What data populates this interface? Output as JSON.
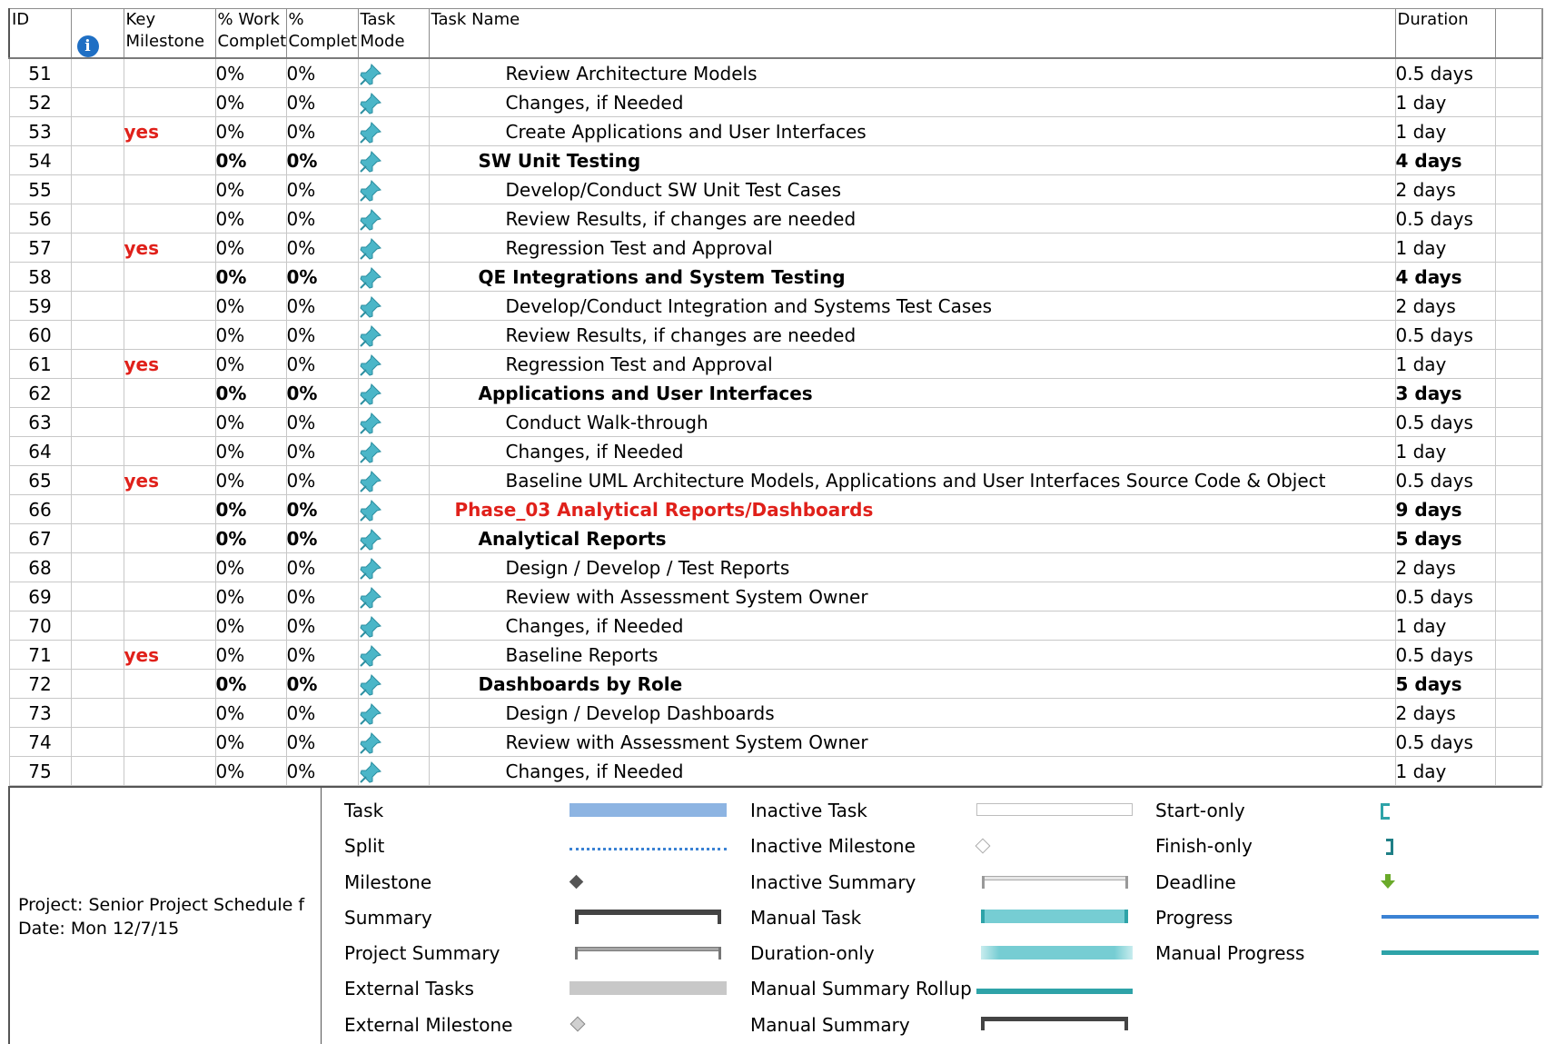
{
  "columns": {
    "id": "ID",
    "info_icon": "info-icon",
    "key_milestone": "Key Milestone",
    "pct_work": "% Work Complet",
    "pct_complete": "% Complet",
    "task_mode": "Task Mode",
    "task_name": "Task Name",
    "duration": "Duration"
  },
  "rows": [
    {
      "id": "51",
      "ms": "",
      "work": "0%",
      "comp": "0%",
      "name": "Review Architecture Models",
      "dur": "0.5 days",
      "level": 3,
      "bold": false,
      "phase": false
    },
    {
      "id": "52",
      "ms": "",
      "work": "0%",
      "comp": "0%",
      "name": "Changes, if Needed",
      "dur": "1 day",
      "level": 3,
      "bold": false,
      "phase": false
    },
    {
      "id": "53",
      "ms": "yes",
      "work": "0%",
      "comp": "0%",
      "name": "Create Applications and User Interfaces",
      "dur": "1 day",
      "level": 3,
      "bold": false,
      "phase": false
    },
    {
      "id": "54",
      "ms": "",
      "work": "0%",
      "comp": "0%",
      "name": "SW Unit Testing",
      "dur": "4 days",
      "level": 2,
      "bold": true,
      "phase": false
    },
    {
      "id": "55",
      "ms": "",
      "work": "0%",
      "comp": "0%",
      "name": "Develop/Conduct SW Unit Test Cases",
      "dur": "2 days",
      "level": 3,
      "bold": false,
      "phase": false
    },
    {
      "id": "56",
      "ms": "",
      "work": "0%",
      "comp": "0%",
      "name": "Review Results, if changes are needed",
      "dur": "0.5 days",
      "level": 3,
      "bold": false,
      "phase": false
    },
    {
      "id": "57",
      "ms": "yes",
      "work": "0%",
      "comp": "0%",
      "name": "Regression Test and Approval",
      "dur": "1 day",
      "level": 3,
      "bold": false,
      "phase": false
    },
    {
      "id": "58",
      "ms": "",
      "work": "0%",
      "comp": "0%",
      "name": "QE Integrations and System Testing",
      "dur": "4 days",
      "level": 2,
      "bold": true,
      "phase": false
    },
    {
      "id": "59",
      "ms": "",
      "work": "0%",
      "comp": "0%",
      "name": "Develop/Conduct Integration and Systems Test Cases",
      "dur": "2 days",
      "level": 3,
      "bold": false,
      "phase": false
    },
    {
      "id": "60",
      "ms": "",
      "work": "0%",
      "comp": "0%",
      "name": "Review Results, if changes are needed",
      "dur": "0.5 days",
      "level": 3,
      "bold": false,
      "phase": false
    },
    {
      "id": "61",
      "ms": "yes",
      "work": "0%",
      "comp": "0%",
      "name": "Regression Test and Approval",
      "dur": "1 day",
      "level": 3,
      "bold": false,
      "phase": false
    },
    {
      "id": "62",
      "ms": "",
      "work": "0%",
      "comp": "0%",
      "name": "Applications and User Interfaces",
      "dur": "3 days",
      "level": 2,
      "bold": true,
      "phase": false
    },
    {
      "id": "63",
      "ms": "",
      "work": "0%",
      "comp": "0%",
      "name": "Conduct Walk-through",
      "dur": "0.5 days",
      "level": 3,
      "bold": false,
      "phase": false
    },
    {
      "id": "64",
      "ms": "",
      "work": "0%",
      "comp": "0%",
      "name": "Changes, if Needed",
      "dur": "1 day",
      "level": 3,
      "bold": false,
      "phase": false
    },
    {
      "id": "65",
      "ms": "yes",
      "work": "0%",
      "comp": "0%",
      "name": "Baseline UML Architecture Models, Applications and User Interfaces Source Code & Object",
      "dur": "0.5 days",
      "level": 3,
      "bold": false,
      "phase": false
    },
    {
      "id": "66",
      "ms": "",
      "work": "0%",
      "comp": "0%",
      "name": "Phase_03  Analytical Reports/Dashboards",
      "dur": "9 days",
      "level": 1,
      "bold": true,
      "phase": true
    },
    {
      "id": "67",
      "ms": "",
      "work": "0%",
      "comp": "0%",
      "name": "Analytical Reports",
      "dur": "5 days",
      "level": 2,
      "bold": true,
      "phase": false
    },
    {
      "id": "68",
      "ms": "",
      "work": "0%",
      "comp": "0%",
      "name": "Design / Develop / Test Reports",
      "dur": "2 days",
      "level": 3,
      "bold": false,
      "phase": false
    },
    {
      "id": "69",
      "ms": "",
      "work": "0%",
      "comp": "0%",
      "name": "Review with Assessment System Owner",
      "dur": "0.5 days",
      "level": 3,
      "bold": false,
      "phase": false
    },
    {
      "id": "70",
      "ms": "",
      "work": "0%",
      "comp": "0%",
      "name": "Changes, if Needed",
      "dur": "1 day",
      "level": 3,
      "bold": false,
      "phase": false
    },
    {
      "id": "71",
      "ms": "yes",
      "work": "0%",
      "comp": "0%",
      "name": "Baseline Reports",
      "dur": "0.5 days",
      "level": 3,
      "bold": false,
      "phase": false
    },
    {
      "id": "72",
      "ms": "",
      "work": "0%",
      "comp": "0%",
      "name": "Dashboards by Role",
      "dur": "5 days",
      "level": 2,
      "bold": true,
      "phase": false
    },
    {
      "id": "73",
      "ms": "",
      "work": "0%",
      "comp": "0%",
      "name": "Design / Develop Dashboards",
      "dur": "2 days",
      "level": 3,
      "bold": false,
      "phase": false
    },
    {
      "id": "74",
      "ms": "",
      "work": "0%",
      "comp": "0%",
      "name": "Review with Assessment System Owner",
      "dur": "0.5 days",
      "level": 3,
      "bold": false,
      "phase": false
    },
    {
      "id": "75",
      "ms": "",
      "work": "0%",
      "comp": "0%",
      "name": "Changes, if Needed",
      "dur": "1 day",
      "level": 3,
      "bold": false,
      "phase": false
    }
  ],
  "project_info": {
    "project": "Project: Senior Project Schedule f",
    "date": "Date: Mon 12/7/15"
  },
  "legend": {
    "col1": [
      "Task",
      "Split",
      "Milestone",
      "Summary",
      "Project Summary",
      "External Tasks",
      "External Milestone"
    ],
    "col2": [
      "Inactive Task",
      "Inactive Milestone",
      "Inactive Summary",
      "Manual Task",
      "Duration-only",
      "Manual Summary Rollup",
      "Manual Summary"
    ],
    "col3": [
      "Start-only",
      "Finish-only",
      "Deadline",
      "Progress",
      "Manual Progress"
    ]
  },
  "colors": {
    "milestone_red": "#e0201a",
    "task_blue": "#8db4e2",
    "manual_teal": "#76cdd3",
    "rollup_teal": "#2ea3a8",
    "progress_blue": "#3b82d4",
    "deadline_green": "#6aaa2a",
    "pin_teal": "#4bb6c8"
  }
}
